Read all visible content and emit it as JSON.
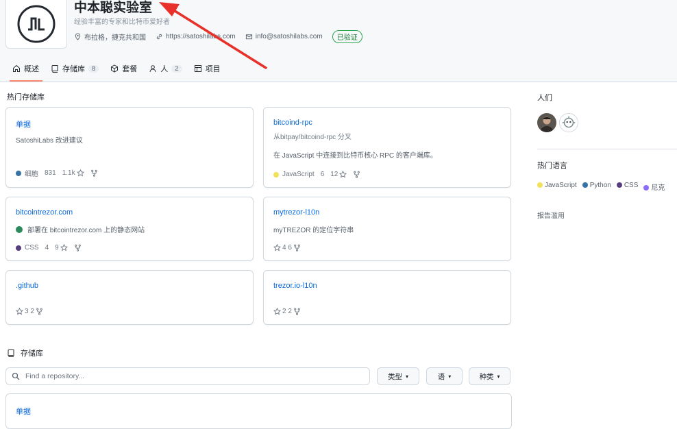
{
  "org": {
    "name": "中本聪实验室",
    "description": "经验丰富的专家和比特币爱好者",
    "location": "布拉格，捷克共和国",
    "website": "https://satoshilabs.com",
    "email": "info@satoshilabs.com",
    "verified_label": "已验证"
  },
  "tabs": [
    {
      "label": "概述",
      "icon": "book-icon",
      "active": true
    },
    {
      "label": "存储库",
      "icon": "repo-icon",
      "count": "8"
    },
    {
      "label": "套餐",
      "icon": "package-icon"
    },
    {
      "label": "人",
      "icon": "person-icon",
      "count": "2"
    },
    {
      "label": "项目",
      "icon": "table-icon"
    }
  ],
  "popular": {
    "title": "热门存储库",
    "repos": [
      {
        "name": "单据",
        "desc": "SatoshiLabs 改进建议",
        "lang": "细胞",
        "lang_color": "#3572A5",
        "count": "831",
        "stars": "1.1k"
      },
      {
        "name": "bitcoind-rpc",
        "fork": "从bitpay/bitcoind-rpc 分叉",
        "desc": "在 JavaScript 中连接到比特币核心 RPC 的客户端库。",
        "lang": "JavaScript",
        "lang_color": "#f1e05a",
        "count": "6",
        "stars": "12"
      },
      {
        "name": "bitcointrezor.com",
        "desc": "部署在 bitcointrezor.com 上的静态网站",
        "lang": "CSS",
        "lang_color": "#563d7c",
        "count": "4",
        "stars": "9"
      },
      {
        "name": "mytrezor-l10n",
        "desc": "myTREZOR 的定位字符串",
        "stats": "4 6"
      },
      {
        "name": ".github",
        "stats": "3 2"
      },
      {
        "name": "trezor.io-l10n",
        "stats": "2 2"
      }
    ]
  },
  "repositories": {
    "title": "存储库",
    "search_placeholder": "Find a repository...",
    "filters": [
      "类型",
      "语",
      "种类"
    ],
    "first_item": "单据"
  },
  "sidebar": {
    "people_title": "人们",
    "languages_title": "热门语言",
    "languages": [
      {
        "name": "JavaScript",
        "color": "#f1e05a"
      },
      {
        "name": "Python",
        "color": "#3572A5"
      },
      {
        "name": "CSS",
        "color": "#563d7c"
      },
      {
        "name": "尼克",
        "color": "#8b6cff"
      }
    ],
    "report": "报告滥用"
  }
}
